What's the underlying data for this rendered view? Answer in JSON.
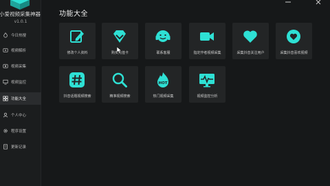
{
  "app": {
    "title": "小爱视频采集神器",
    "version": "v1.0.1",
    "accent": "#2ee0d4"
  },
  "sidebar": {
    "items": [
      {
        "label": "今日热搜",
        "icon": "flame-icon"
      },
      {
        "label": "视频解析",
        "icon": "video-parse-icon"
      },
      {
        "label": "视频采集",
        "icon": "video-collect-icon"
      },
      {
        "label": "视频监控",
        "icon": "monitor-icon"
      },
      {
        "label": "功能大全",
        "icon": "grid-icon",
        "active": true
      },
      {
        "label": "个人中心",
        "icon": "user-icon"
      },
      {
        "label": "程序设置",
        "icon": "gear-icon"
      },
      {
        "label": "更新记录",
        "icon": "document-icon"
      }
    ]
  },
  "main": {
    "title": "功能大全",
    "cards": [
      {
        "label": "修改个人资料",
        "icon": "edit-icon"
      },
      {
        "label": "购买充值卡",
        "icon": "diamond-icon"
      },
      {
        "label": "联系客服",
        "icon": "headset-icon"
      },
      {
        "label": "指定作者视频采集",
        "icon": "video-camera-icon"
      },
      {
        "label": "采集抖音关注用户",
        "icon": "heart-icon"
      },
      {
        "label": "采集抖音喜欢视频",
        "icon": "heart-circle-icon"
      },
      {
        "label": "抖音话题视频搜索",
        "icon": "hashtag-icon"
      },
      {
        "label": "精准视频搜索",
        "icon": "magnifier-icon"
      },
      {
        "label": "热门视频采集",
        "icon": "hot-flame-icon"
      },
      {
        "label": "视频监控分析",
        "icon": "analytics-monitor-icon"
      }
    ],
    "hot_badge": "HOT"
  }
}
